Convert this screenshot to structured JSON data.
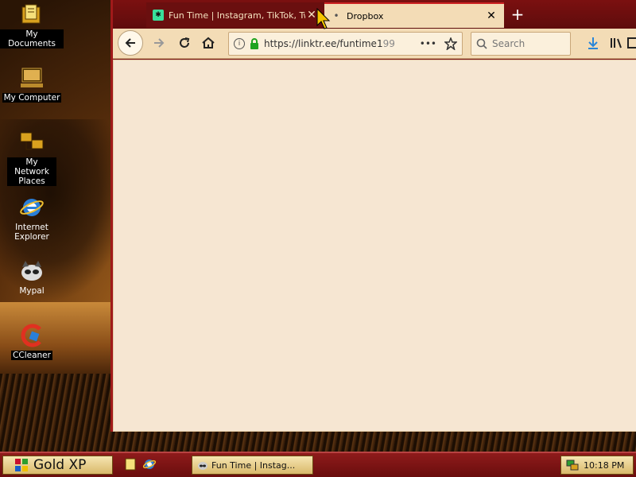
{
  "desktop": {
    "icons": [
      {
        "label": "My Documents",
        "icon": "folder-documents-icon"
      },
      {
        "label": "My Computer",
        "icon": "computer-icon"
      },
      {
        "label": "My Network Places",
        "icon": "network-places-icon"
      },
      {
        "label": "Internet Explorer",
        "icon": "internet-explorer-icon"
      },
      {
        "label": "Mypal",
        "icon": "mypal-icon"
      },
      {
        "label": "CCleaner",
        "icon": "ccleaner-icon"
      }
    ]
  },
  "browser": {
    "tabs": [
      {
        "title": "Fun Time | Instagram, TikTok, Twitt",
        "close": "✕",
        "active": false
      },
      {
        "title": "Dropbox",
        "close": "✕",
        "active": true
      }
    ],
    "new_tab": "+",
    "url": {
      "main": "https://linktr.ee/funtime1",
      "faded": "99"
    },
    "search_placeholder": "Search",
    "more": "•••"
  },
  "taskbar": {
    "start_label": "Gold XP",
    "task_label": "Fun Time | Instag...",
    "clock": "10:18 PM"
  },
  "colors": {
    "window_frame": "#7a1414",
    "toolbar_bg": "#f3dcb6",
    "content_bg": "#f6e6d2",
    "download_arrow": "#2a86d8"
  }
}
